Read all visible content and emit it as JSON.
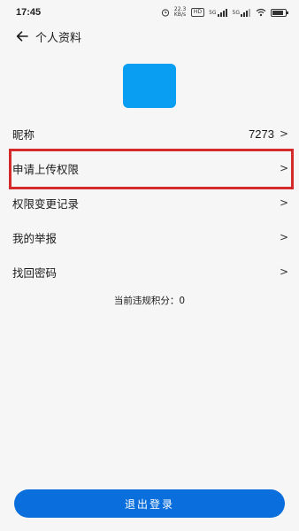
{
  "status_bar": {
    "time": "17:45",
    "speed": "22.3 KB/s",
    "hd": "HD",
    "net1": "5G",
    "net2": "5G"
  },
  "header": {
    "title": "个人资料"
  },
  "profile": {
    "nickname_label": "昵称",
    "nickname_value": "7273",
    "avatar_color": "#0a9ef2"
  },
  "menu": {
    "items": [
      {
        "label": "申请上传权限"
      },
      {
        "label": "权限变更记录"
      },
      {
        "label": "我的举报"
      },
      {
        "label": "找回密码"
      }
    ],
    "chevron": ">"
  },
  "violation": {
    "text": "当前违规积分：0"
  },
  "footer": {
    "logout_label": "退出登录",
    "logout_color": "#0a6fdc"
  },
  "highlight_color": "#d42a2a"
}
